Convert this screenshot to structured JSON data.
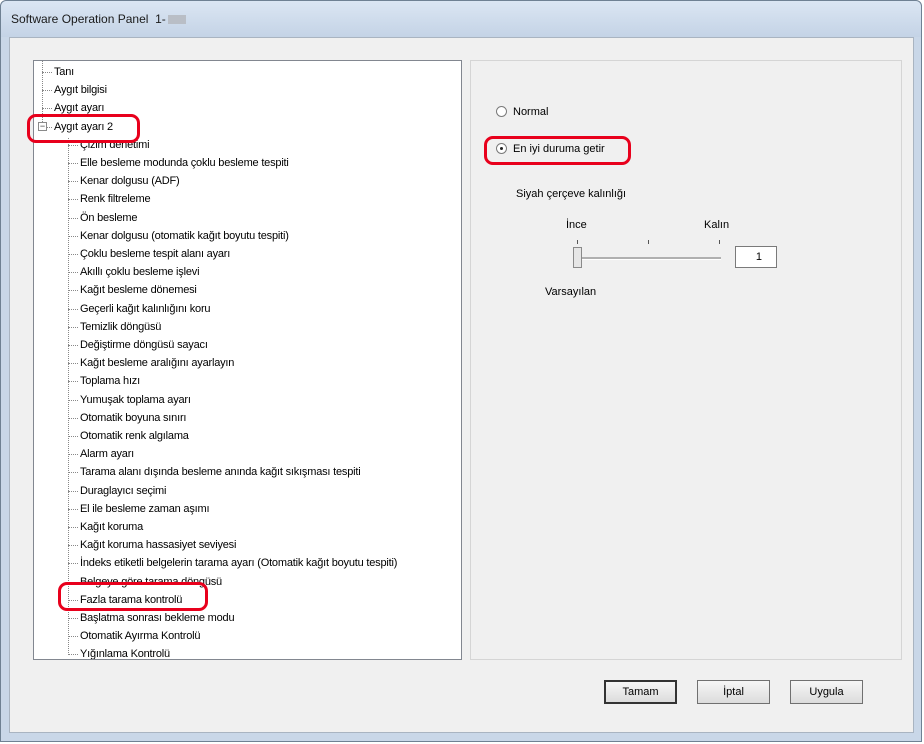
{
  "window": {
    "title": "Software Operation Panel  1-"
  },
  "tree": {
    "items": [
      {
        "label": "Tanı",
        "level": 0
      },
      {
        "label": "Aygıt bilgisi",
        "level": 0
      },
      {
        "label": "Aygıt ayarı",
        "level": 0
      },
      {
        "label": "Aygıt ayarı 2",
        "level": 0,
        "expanded": true
      },
      {
        "label": "Çizim denetimi",
        "level": 1
      },
      {
        "label": "Elle besleme modunda çoklu besleme tespiti",
        "level": 1
      },
      {
        "label": "Kenar dolgusu (ADF)",
        "level": 1
      },
      {
        "label": "Renk filtreleme",
        "level": 1
      },
      {
        "label": "Ön besleme",
        "level": 1
      },
      {
        "label": "Kenar dolgusu (otomatik kağıt boyutu tespiti)",
        "level": 1
      },
      {
        "label": "Çoklu besleme tespit alanı ayarı",
        "level": 1
      },
      {
        "label": "Akıllı çoklu besleme işlevi",
        "level": 1
      },
      {
        "label": "Kağıt besleme dönemesi",
        "level": 1
      },
      {
        "label": "Geçerli kağıt kalınlığını koru",
        "level": 1
      },
      {
        "label": "Temizlik döngüsü",
        "level": 1
      },
      {
        "label": "Değiştirme döngüsü sayacı",
        "level": 1
      },
      {
        "label": "Kağıt besleme aralığını ayarlayın",
        "level": 1
      },
      {
        "label": "Toplama hızı",
        "level": 1
      },
      {
        "label": "Yumuşak toplama ayarı",
        "level": 1
      },
      {
        "label": "Otomatik boyuna sınırı",
        "level": 1
      },
      {
        "label": "Otomatik renk algılama",
        "level": 1
      },
      {
        "label": "Alarm ayarı",
        "level": 1
      },
      {
        "label": "Tarama alanı dışında besleme anında kağıt sıkışması tespiti",
        "level": 1
      },
      {
        "label": "Duraglayıcı seçimi",
        "level": 1
      },
      {
        "label": "El ile besleme zaman aşımı",
        "level": 1
      },
      {
        "label": "Kağıt koruma",
        "level": 1
      },
      {
        "label": "Kağıt koruma hassasiyet seviyesi",
        "level": 1
      },
      {
        "label": "İndeks etiketli belgelerin tarama ayarı (Otomatik kağıt boyutu tespiti)",
        "level": 1
      },
      {
        "label": "Belgeye göre tarama döngüsü",
        "level": 1
      },
      {
        "label": "Fazla tarama kontrolü",
        "level": 1,
        "highlighted": true
      },
      {
        "label": "Başlatma sonrası bekleme modu",
        "level": 1
      },
      {
        "label": "Otomatik Ayırma Kontrolü",
        "level": 1
      },
      {
        "label": "Yığınlama Kontrolü",
        "level": 1
      }
    ]
  },
  "settings": {
    "radio_normal": "Normal",
    "radio_best": "En iyi duruma getir",
    "selected": "radio_best",
    "section_label": "Siyah çerçeve kalınlığı",
    "slider_min_label": "İnce",
    "slider_max_label": "Kalın",
    "slider_value": "1",
    "slider_level": 0,
    "slider_default_label": "Varsayılan"
  },
  "buttons": {
    "ok": "Tamam",
    "cancel": "İptal",
    "apply": "Uygula"
  },
  "colors": {
    "highlight": "#e8001c"
  }
}
